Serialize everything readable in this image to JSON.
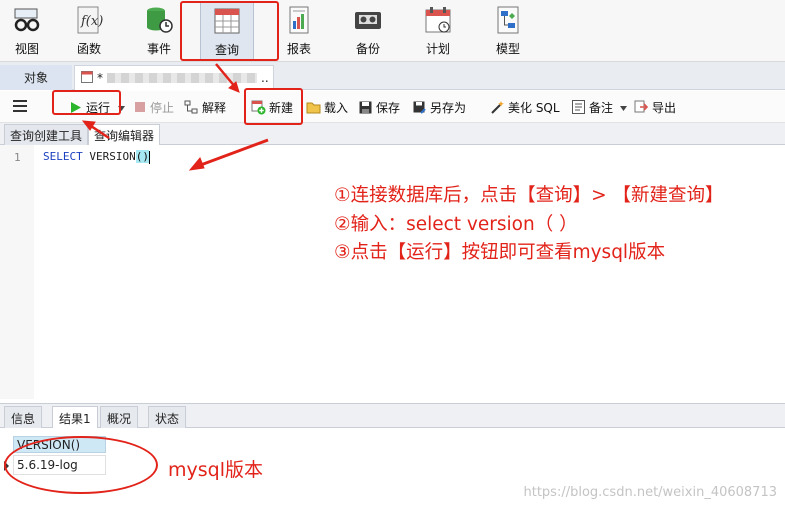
{
  "ribbon": {
    "items": [
      {
        "label": "视图",
        "icon": "glasses-icon"
      },
      {
        "label": "函数",
        "icon": "function-icon"
      },
      {
        "label": "事件",
        "icon": "database-clock-icon"
      },
      {
        "label": "查询",
        "icon": "query-table-icon"
      },
      {
        "label": "报表",
        "icon": "report-icon"
      },
      {
        "label": "备份",
        "icon": "backup-tape-icon"
      },
      {
        "label": "计划",
        "icon": "calendar-icon"
      },
      {
        "label": "模型",
        "icon": "model-icon"
      }
    ]
  },
  "object_tabs": {
    "objects": "对象",
    "query_prefix": "*",
    "query_suffix": ".."
  },
  "toolbar": {
    "run": "运行",
    "stop": "停止",
    "explain": "解释",
    "new": "新建",
    "load": "载入",
    "save": "保存",
    "save_as": "另存为",
    "beautify": "美化 SQL",
    "note": "备注",
    "export": "导出"
  },
  "sub_tabs": {
    "builder": "查询创建工具",
    "editor": "查询编辑器"
  },
  "editor": {
    "line": "1",
    "keyword": "SELECT",
    "func": "VERSION",
    "parens": "()"
  },
  "annotations": {
    "step1": "①连接数据库后，点击【查询】> 【新建查询】",
    "step2": "②输入：select version（ ）",
    "step3": "③点击【运行】按钮即可查看mysql版本",
    "version_note": "mysql版本"
  },
  "result_tabs": [
    "信息",
    "结果1",
    "概况",
    "状态"
  ],
  "result": {
    "column": "VERSION()",
    "value": "5.6.19-log"
  },
  "watermark": "https://blog.csdn.net/weixin_40608713",
  "colors": {
    "annotation_red": "#e2231a",
    "run_green": "#2bb52b",
    "keyword_blue": "#1a3fbf"
  }
}
